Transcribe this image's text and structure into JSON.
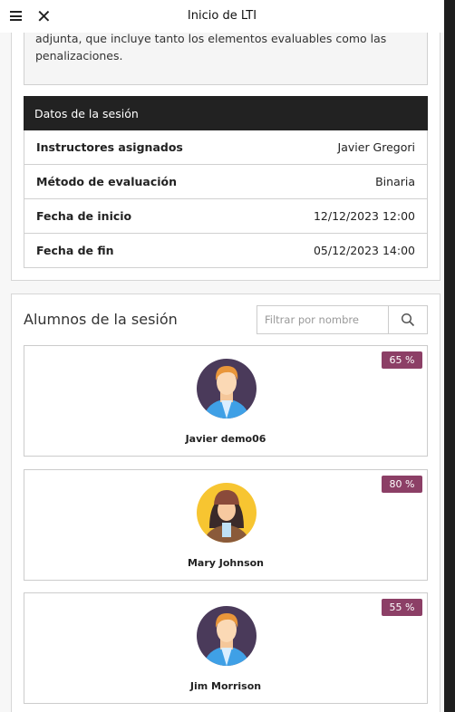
{
  "header": {
    "title": "Inicio de LTI",
    "menu_icon": "hamburger-icon",
    "close_icon": "close-icon"
  },
  "description": {
    "text": "adjunta, que incluye tanto los elementos evaluables como las penalizaciones."
  },
  "session": {
    "heading": "Datos de la sesión",
    "rows": [
      {
        "label": "Instructores asignados",
        "value": "Javier Gregori"
      },
      {
        "label": "Método de evaluación",
        "value": "Binaria"
      },
      {
        "label": "Fecha de inicio",
        "value": "12/12/2023 12:00"
      },
      {
        "label": "Fecha de fin",
        "value": "05/12/2023 14:00"
      }
    ]
  },
  "students": {
    "heading": "Alumnos de la sesión",
    "search_placeholder": "Filtrar por nombre",
    "search_value": "",
    "badge_color": "#8c3f66",
    "items": [
      {
        "name": "Javier demo06",
        "score": "65 %",
        "avatar": "male-blond"
      },
      {
        "name": "Mary Johnson",
        "score": "80 %",
        "avatar": "female-beanie"
      },
      {
        "name": "Jim Morrison",
        "score": "55 %",
        "avatar": "male-blond"
      }
    ]
  }
}
